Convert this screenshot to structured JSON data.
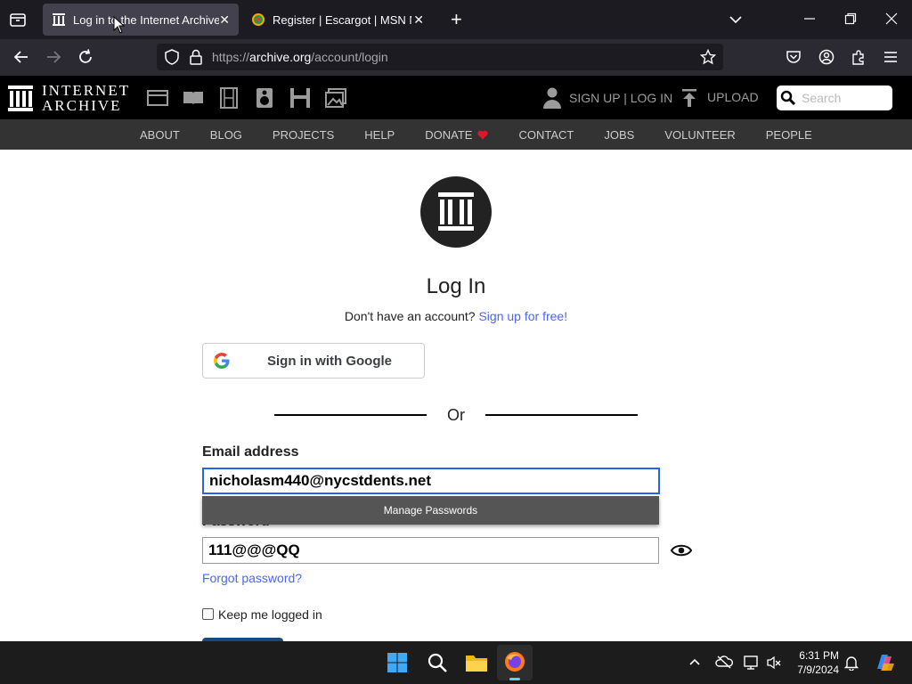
{
  "browser": {
    "tabs": [
      {
        "title": "Log in to the Internet Archive",
        "active": true
      },
      {
        "title": "Register | Escargot | MSN Messenger",
        "active": false
      }
    ],
    "url_host": "archive.org",
    "url_path": "/account/login",
    "url_scheme": "https://",
    "new_tab_symbol": "+",
    "close_symbol": "✕"
  },
  "ia_header": {
    "logo_line1": "INTERNET",
    "logo_line2": "ARCHIVE",
    "signup_login": "SIGN UP | LOG IN",
    "upload": "UPLOAD",
    "search_placeholder": "Search",
    "menu": [
      "ABOUT",
      "BLOG",
      "PROJECTS",
      "HELP",
      "DONATE",
      "CONTACT",
      "JOBS",
      "VOLUNTEER",
      "PEOPLE"
    ],
    "accent_heart": "#e0162b"
  },
  "login": {
    "heading": "Log In",
    "no_account": "Don't have an account?",
    "signup_link": "Sign up for free!",
    "google_button": "Sign in with Google",
    "or": "Or",
    "email_label": "Email address",
    "email_value": "nicholasm440@nycstdents.net",
    "manage_passwords": "Manage Passwords",
    "password_label": "Password",
    "password_value": "111@@@QQ",
    "forgot": "Forgot password?",
    "keep_logged_in": "Keep me logged in",
    "link_color": "#4b64ff"
  },
  "taskbar": {
    "time": "6:31 PM",
    "date": "7/9/2024"
  }
}
